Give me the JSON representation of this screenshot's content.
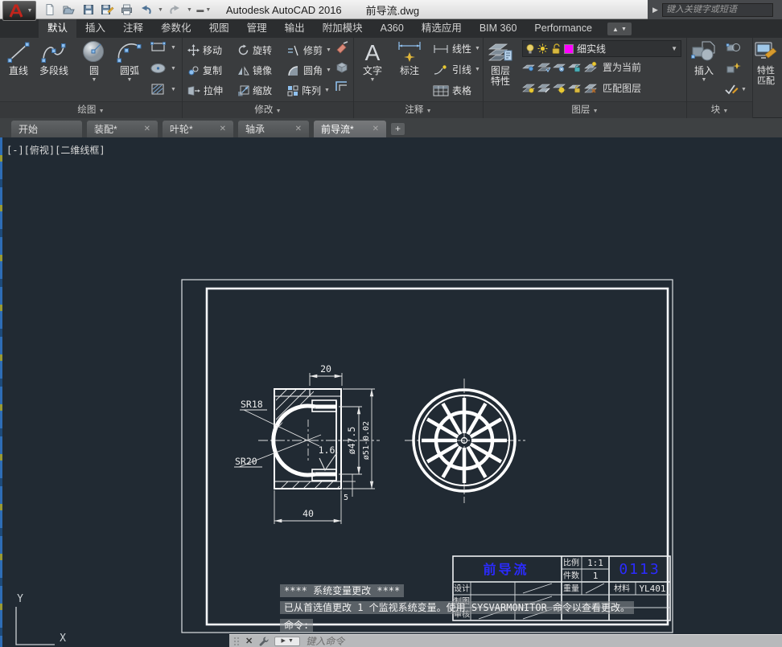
{
  "icons": {
    "chevron_down": "▼",
    "close": "✕",
    "plus": "+",
    "play": "▶",
    "collapse_up": "▲"
  },
  "title_bar": {
    "app_name": "Autodesk AutoCAD 2016",
    "doc_name": "前导流.dwg",
    "search_placeholder": "键入关键字或短语"
  },
  "ribbon": {
    "tabs": [
      "默认",
      "插入",
      "注释",
      "参数化",
      "视图",
      "管理",
      "输出",
      "附加模块",
      "A360",
      "精选应用",
      "BIM 360",
      "Performance"
    ],
    "panels": {
      "draw": {
        "label": "绘图",
        "line": "直线",
        "polyline": "多段线",
        "circle": "圆",
        "arc": "圆弧"
      },
      "modify": {
        "label": "修改",
        "move": "移动",
        "rotate": "旋转",
        "trim": "修剪",
        "copy": "复制",
        "mirror": "镜像",
        "fillet": "圆角",
        "stretch": "拉伸",
        "scale": "缩放",
        "array": "阵列"
      },
      "annotate": {
        "label": "注释",
        "text": "文字",
        "dimension": "标注",
        "linear": "线性",
        "leader": "引线",
        "table": "表格"
      },
      "layers": {
        "label": "图层",
        "props_line1": "图层",
        "props_line2": "特性",
        "current_layer": "细实线",
        "layer_color": "#ff00ff",
        "set_current": "置为当前",
        "match_layer": "匹配图层"
      },
      "block": {
        "label": "块",
        "insert": "插入"
      },
      "match_props": {
        "line1": "特性",
        "line2": "匹配"
      }
    }
  },
  "file_tabs": {
    "start": "开始",
    "t1": "装配*",
    "t2": "叶轮*",
    "t3": "轴承",
    "t4": "前导流*"
  },
  "viewport": {
    "label": "[-][俯视][二维线框]",
    "ucs_x": "X",
    "ucs_y": "Y"
  },
  "drawing": {
    "dims": {
      "top_width": "20",
      "bottom_width": "40",
      "dia_inner": "ø47.5",
      "dia_outer": "ø51-0.02",
      "step": "5",
      "sr_top": "SR18",
      "sr_bottom": "SR20",
      "roughness": "1.6"
    },
    "title_block": {
      "accent": "#2b2bff",
      "part_name": "前导流",
      "scale_label": "比例",
      "scale_value": "1:1",
      "qty_label": "件数",
      "qty_value": "1",
      "drawing_no": "0113",
      "design_label": "设计",
      "weight_label": "重量",
      "material_label": "材料",
      "material_value": "YL401",
      "draft_label": "制图",
      "check_label": "审核"
    }
  },
  "command_line": {
    "msg1": "****  系统变量更改  ****",
    "msg2": "已从首选值更改 1 个监视系统变量。使用 SYSVARMONITOR 命令以查看更改。",
    "prompt": "命令:",
    "input_placeholder": "键入命令"
  }
}
